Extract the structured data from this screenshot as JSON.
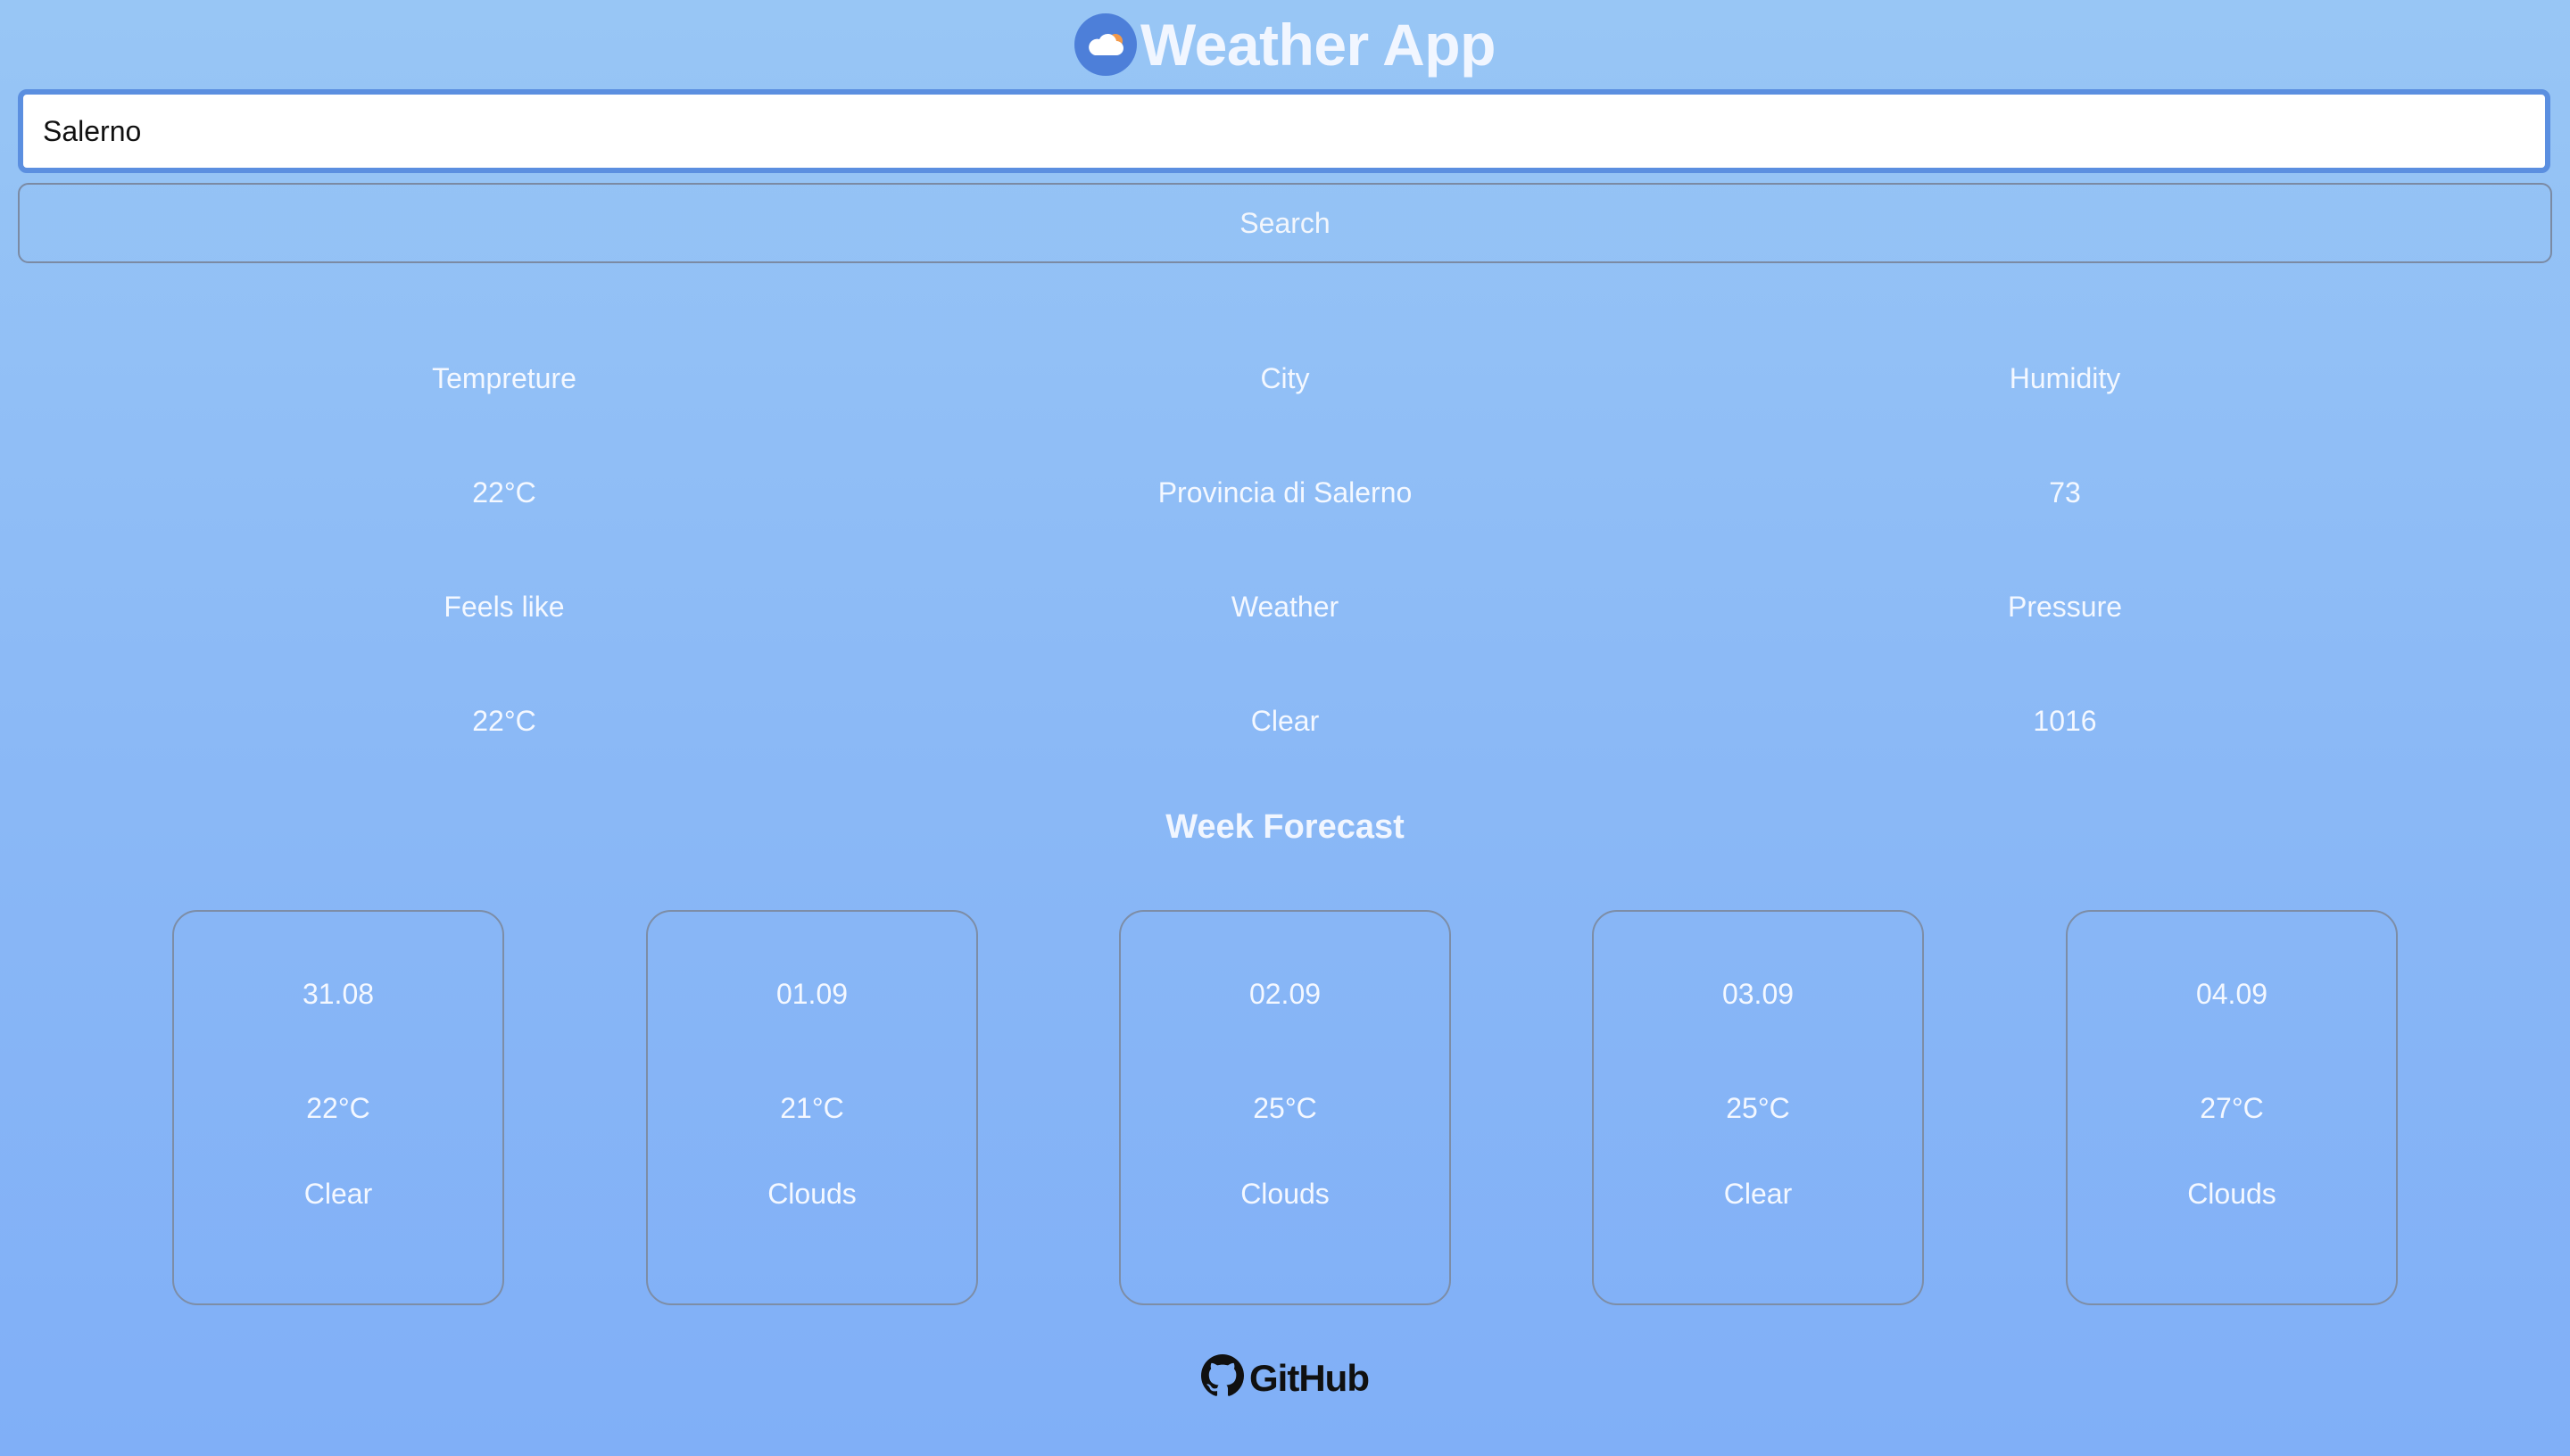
{
  "app": {
    "title": "Weather App",
    "logo_icon": "cloud-sun-icon"
  },
  "search": {
    "value": "Salerno",
    "button_label": "Search"
  },
  "current": {
    "temperature_label": "Tempreture",
    "temperature_value": "22°C",
    "city_label": "City",
    "city_value": "Provincia di Salerno",
    "humidity_label": "Humidity",
    "humidity_value": "73",
    "feels_like_label": "Feels like",
    "feels_like_value": "22°C",
    "weather_label": "Weather",
    "weather_value": "Clear",
    "pressure_label": "Pressure",
    "pressure_value": "1016"
  },
  "forecast": {
    "title": "Week Forecast",
    "days": [
      {
        "date": "31.08",
        "temp": "22°C",
        "condition": "Clear"
      },
      {
        "date": "01.09",
        "temp": "21°C",
        "condition": "Clouds"
      },
      {
        "date": "02.09",
        "temp": "25°C",
        "condition": "Clouds"
      },
      {
        "date": "03.09",
        "temp": "25°C",
        "condition": "Clear"
      },
      {
        "date": "04.09",
        "temp": "27°C",
        "condition": "Clouds"
      }
    ]
  },
  "footer": {
    "link_label": "GitHub",
    "icon": "github-icon"
  },
  "colors": {
    "background_top": "#98c6f5",
    "background_bottom": "#80aff7",
    "logo_circle": "#4d7fd9",
    "input_focus_border": "#5b8fe0",
    "sun_accent": "#f2994a"
  }
}
